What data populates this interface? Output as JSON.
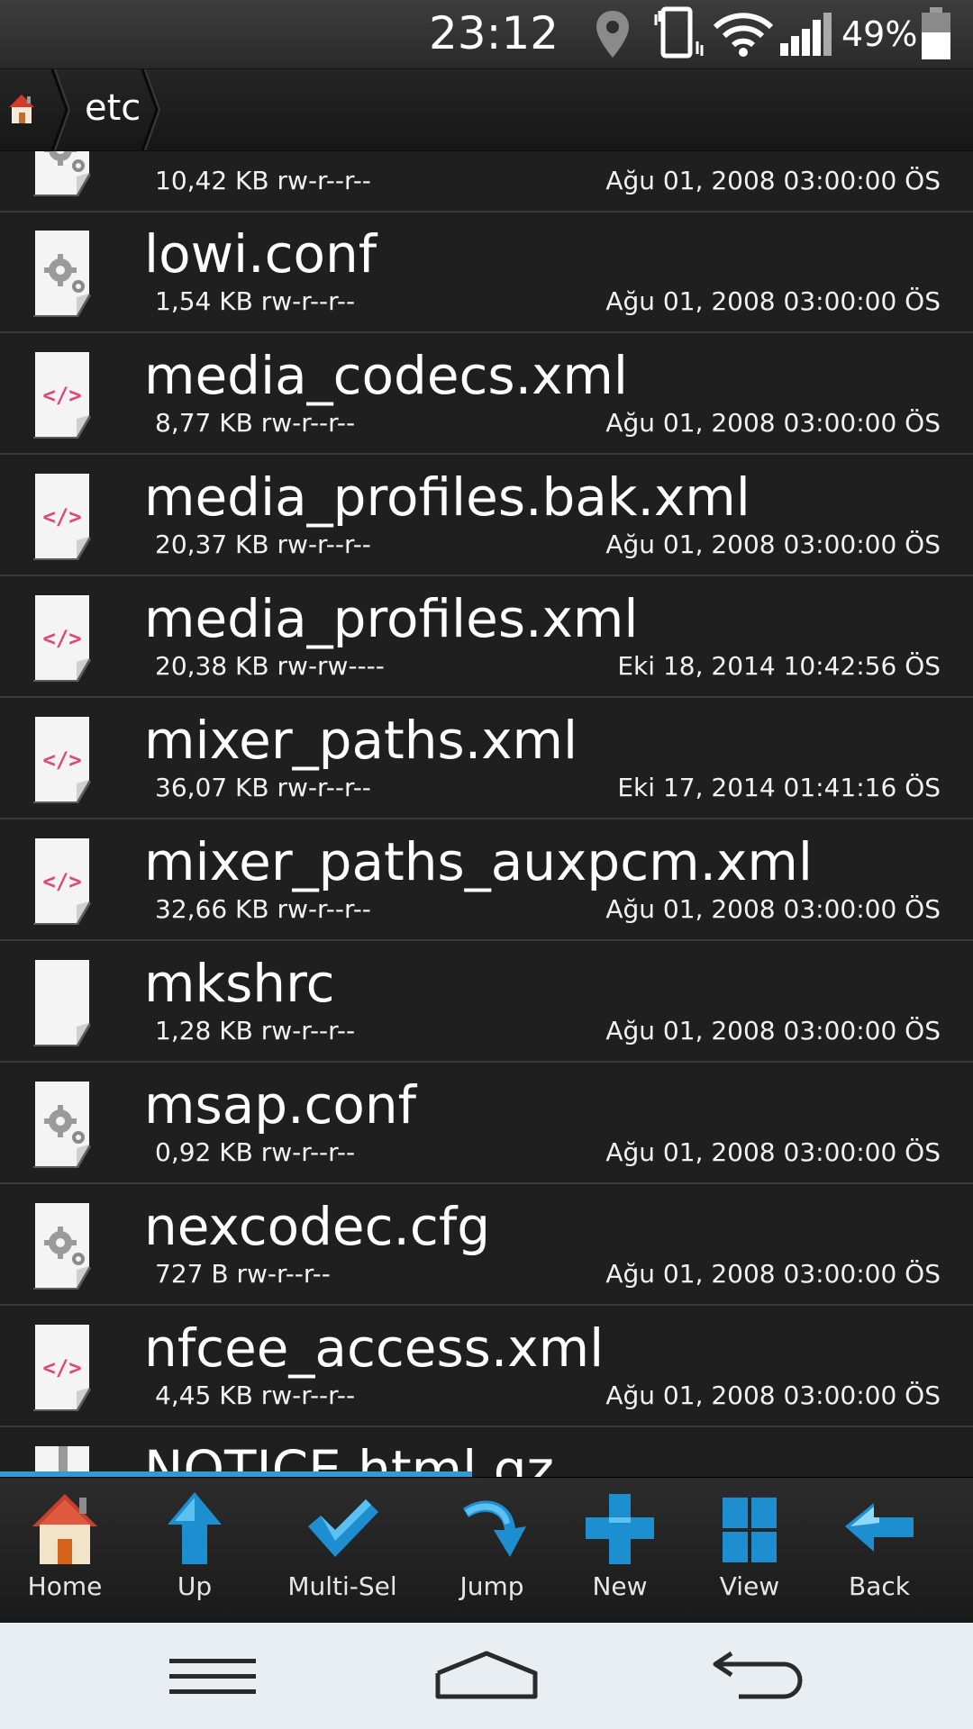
{
  "status_bar": {
    "time": "23:12",
    "battery_percent": "49%",
    "icons": [
      "location-icon",
      "vibrate-icon",
      "wifi-icon",
      "signal-icon",
      "battery-icon"
    ]
  },
  "breadcrumb": {
    "home_icon": "home-icon",
    "current": "etc"
  },
  "files": [
    {
      "name": "",
      "meta": "10,42 KB rw-r--r--",
      "date": "Ağu 01, 2008 03:00:00 ÖS",
      "icon": "gear-file-icon"
    },
    {
      "name": "lowi.conf",
      "meta": "1,54 KB rw-r--r--",
      "date": "Ağu 01, 2008 03:00:00 ÖS",
      "icon": "gear-file-icon"
    },
    {
      "name": "media_codecs.xml",
      "meta": "8,77 KB rw-r--r--",
      "date": "Ağu 01, 2008 03:00:00 ÖS",
      "icon": "xml-file-icon"
    },
    {
      "name": "media_profiles.bak.xml",
      "meta": "20,37 KB rw-r--r--",
      "date": "Ağu 01, 2008 03:00:00 ÖS",
      "icon": "xml-file-icon"
    },
    {
      "name": "media_profiles.xml",
      "meta": "20,38 KB rw-rw----",
      "date": "Eki 18, 2014 10:42:56 ÖS",
      "icon": "xml-file-icon"
    },
    {
      "name": "mixer_paths.xml",
      "meta": "36,07 KB rw-r--r--",
      "date": "Eki 17, 2014 01:41:16 ÖS",
      "icon": "xml-file-icon"
    },
    {
      "name": "mixer_paths_auxpcm.xml",
      "meta": "32,66 KB rw-r--r--",
      "date": "Ağu 01, 2008 03:00:00 ÖS",
      "icon": "xml-file-icon"
    },
    {
      "name": "mkshrc",
      "meta": "1,28 KB rw-r--r--",
      "date": "Ağu 01, 2008 03:00:00 ÖS",
      "icon": "blank-file-icon"
    },
    {
      "name": "msap.conf",
      "meta": "0,92 KB rw-r--r--",
      "date": "Ağu 01, 2008 03:00:00 ÖS",
      "icon": "gear-file-icon"
    },
    {
      "name": "nexcodec.cfg",
      "meta": "727 B rw-r--r--",
      "date": "Ağu 01, 2008 03:00:00 ÖS",
      "icon": "gear-file-icon"
    },
    {
      "name": "nfcee_access.xml",
      "meta": "4,45 KB rw-r--r--",
      "date": "Ağu 01, 2008 03:00:00 ÖS",
      "icon": "xml-file-icon"
    },
    {
      "name": "NOTICE.html.gz",
      "meta": "",
      "date": "",
      "icon": "zip-file-icon"
    }
  ],
  "toolbar": [
    {
      "label": "Home",
      "icon": "house-icon"
    },
    {
      "label": "Up",
      "icon": "up-arrow-icon"
    },
    {
      "label": "Multi-Sel",
      "icon": "checkmark-icon"
    },
    {
      "label": "Jump",
      "icon": "jump-arrow-icon"
    },
    {
      "label": "New",
      "icon": "plus-icon"
    },
    {
      "label": "View",
      "icon": "grid-icon"
    },
    {
      "label": "Back",
      "icon": "back-arrow-icon"
    }
  ],
  "nav_bar": {
    "icons": [
      "menu-icon",
      "home-nav-icon",
      "back-nav-icon"
    ]
  },
  "colors": {
    "background": "#1f1f1f",
    "divider": "#3a3a3a",
    "accent_blue": "#2e9bd6",
    "xml_pink": "#e0457b",
    "nav_bar": "#e9eef2"
  }
}
